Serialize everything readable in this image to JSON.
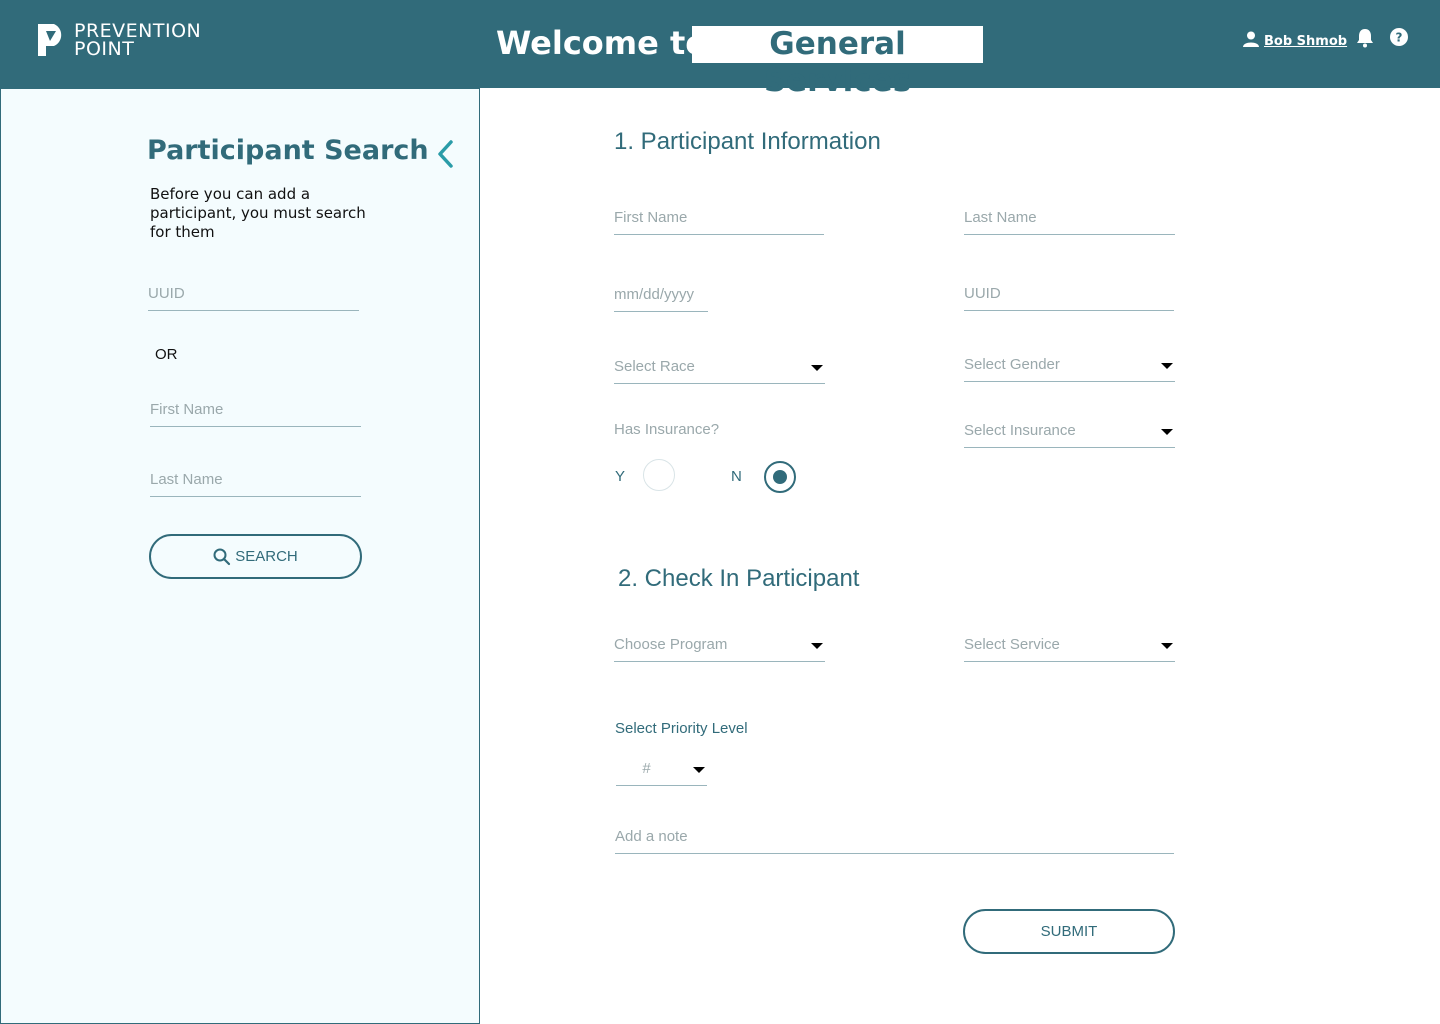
{
  "header": {
    "logo_line1": "PREVENTION",
    "logo_line2": "POINT",
    "welcome": "Welcome to",
    "service": "General Services",
    "user_name": "Bob Shmob",
    "icons": {
      "user": "user-icon",
      "bell": "bell-icon",
      "help": "help-icon"
    }
  },
  "sidebar": {
    "title": "Participant Search",
    "description": "Before you can add a participant, you must search for them",
    "uuid_placeholder": "UUID",
    "or_label": "OR",
    "first_name_placeholder": "First Name",
    "last_name_placeholder": "Last Name",
    "search_label": "SEARCH",
    "icons": {
      "collapse": "chevron-left-icon",
      "search": "search-icon"
    }
  },
  "section1": {
    "title": "1. Participant Information",
    "first_name_placeholder": "First Name",
    "last_name_placeholder": "Last Name",
    "dob_placeholder": "mm/dd/yyyy",
    "uuid_placeholder": "UUID",
    "race_select": "Select Race",
    "gender_select": "Select Gender",
    "insurance_question": "Has Insurance?",
    "insurance_select": "Select Insurance",
    "radio_yes": "Y",
    "radio_no": "N",
    "selected": "N"
  },
  "section2": {
    "title": "2. Check In Participant",
    "program_select": "Choose Program",
    "service_select": "Select Service",
    "priority_label": "Select Priority Level",
    "priority_select": "#",
    "note_placeholder": "Add a note",
    "submit_label": "SUBMIT"
  },
  "colors": {
    "primary": "#316b7a",
    "sidebar_bg": "#f4fcfe",
    "placeholder": "#9aa8ab"
  }
}
